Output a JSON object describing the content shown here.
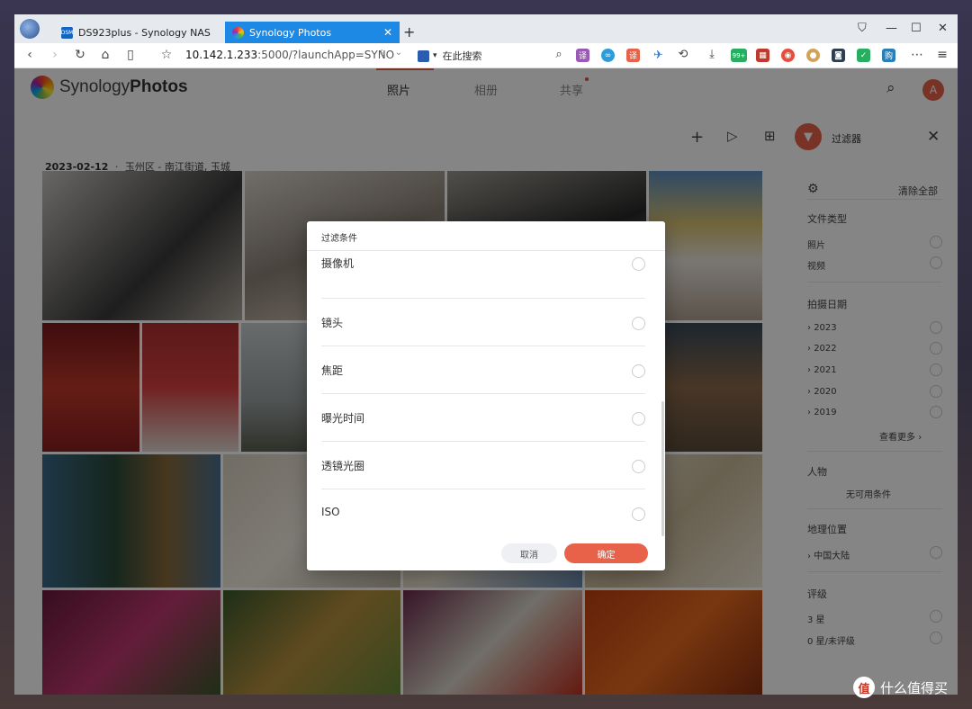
{
  "browser": {
    "tabs": [
      {
        "label": "DS923plus - Synology NAS",
        "favicon": "DSM"
      },
      {
        "label": "Synology Photos"
      }
    ],
    "url": {
      "host": "10.142.1.233",
      "rest": ":5000/?launchApp=SYNO"
    },
    "search_placeholder": "在此搜索",
    "ext_badge": "99+"
  },
  "app": {
    "brand_light": "Synology",
    "brand_bold": "Photos",
    "nav_tabs": [
      "照片",
      "相册",
      "共享"
    ],
    "user_initial": "A",
    "date_header": {
      "date": "2023-02-12",
      "sep": "·",
      "location": "玉州区 - 南江街道, 玉城"
    }
  },
  "filter_panel": {
    "title": "过滤器",
    "clear_all": "清除全部",
    "file_type": {
      "label": "文件类型",
      "items": [
        "照片",
        "视频"
      ]
    },
    "date": {
      "label": "拍摄日期",
      "years": [
        "2023",
        "2022",
        "2021",
        "2020",
        "2019"
      ],
      "see_more": "查看更多"
    },
    "people": {
      "label": "人物",
      "empty": "无可用条件"
    },
    "location": {
      "label": "地理位置",
      "items": [
        "中国大陆"
      ]
    },
    "rating": {
      "label": "评级",
      "items": [
        "3 星",
        "0 星/未评级"
      ]
    }
  },
  "dialog": {
    "title": "过滤条件",
    "items": [
      "摄像机",
      "镜头",
      "焦距",
      "曝光时间",
      "透镜光圈",
      "ISO"
    ],
    "cancel": "取消",
    "confirm": "确定"
  },
  "watermark": {
    "badge": "值",
    "text": "什么值得买"
  },
  "colors": {
    "accent": "#e8624a",
    "tab_active": "#1e88e5"
  }
}
